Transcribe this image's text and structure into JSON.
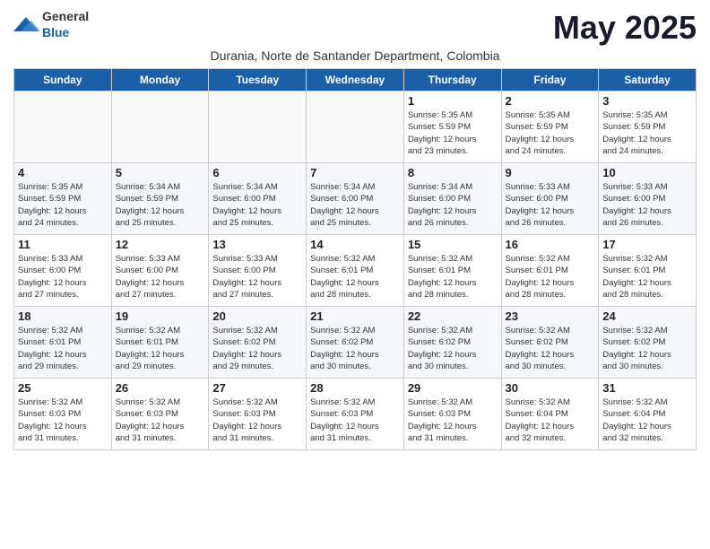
{
  "logo": {
    "general": "General",
    "blue": "Blue"
  },
  "title": {
    "month": "May 2025",
    "location": "Durania, Norte de Santander Department, Colombia"
  },
  "weekdays": [
    "Sunday",
    "Monday",
    "Tuesday",
    "Wednesday",
    "Thursday",
    "Friday",
    "Saturday"
  ],
  "weeks": [
    [
      {
        "day": "",
        "info": ""
      },
      {
        "day": "",
        "info": ""
      },
      {
        "day": "",
        "info": ""
      },
      {
        "day": "",
        "info": ""
      },
      {
        "day": "1",
        "info": "Sunrise: 5:35 AM\nSunset: 5:59 PM\nDaylight: 12 hours\nand 23 minutes."
      },
      {
        "day": "2",
        "info": "Sunrise: 5:35 AM\nSunset: 5:59 PM\nDaylight: 12 hours\nand 24 minutes."
      },
      {
        "day": "3",
        "info": "Sunrise: 5:35 AM\nSunset: 5:59 PM\nDaylight: 12 hours\nand 24 minutes."
      }
    ],
    [
      {
        "day": "4",
        "info": "Sunrise: 5:35 AM\nSunset: 5:59 PM\nDaylight: 12 hours\nand 24 minutes."
      },
      {
        "day": "5",
        "info": "Sunrise: 5:34 AM\nSunset: 5:59 PM\nDaylight: 12 hours\nand 25 minutes."
      },
      {
        "day": "6",
        "info": "Sunrise: 5:34 AM\nSunset: 6:00 PM\nDaylight: 12 hours\nand 25 minutes."
      },
      {
        "day": "7",
        "info": "Sunrise: 5:34 AM\nSunset: 6:00 PM\nDaylight: 12 hours\nand 25 minutes."
      },
      {
        "day": "8",
        "info": "Sunrise: 5:34 AM\nSunset: 6:00 PM\nDaylight: 12 hours\nand 26 minutes."
      },
      {
        "day": "9",
        "info": "Sunrise: 5:33 AM\nSunset: 6:00 PM\nDaylight: 12 hours\nand 26 minutes."
      },
      {
        "day": "10",
        "info": "Sunrise: 5:33 AM\nSunset: 6:00 PM\nDaylight: 12 hours\nand 26 minutes."
      }
    ],
    [
      {
        "day": "11",
        "info": "Sunrise: 5:33 AM\nSunset: 6:00 PM\nDaylight: 12 hours\nand 27 minutes."
      },
      {
        "day": "12",
        "info": "Sunrise: 5:33 AM\nSunset: 6:00 PM\nDaylight: 12 hours\nand 27 minutes."
      },
      {
        "day": "13",
        "info": "Sunrise: 5:33 AM\nSunset: 6:00 PM\nDaylight: 12 hours\nand 27 minutes."
      },
      {
        "day": "14",
        "info": "Sunrise: 5:32 AM\nSunset: 6:01 PM\nDaylight: 12 hours\nand 28 minutes."
      },
      {
        "day": "15",
        "info": "Sunrise: 5:32 AM\nSunset: 6:01 PM\nDaylight: 12 hours\nand 28 minutes."
      },
      {
        "day": "16",
        "info": "Sunrise: 5:32 AM\nSunset: 6:01 PM\nDaylight: 12 hours\nand 28 minutes."
      },
      {
        "day": "17",
        "info": "Sunrise: 5:32 AM\nSunset: 6:01 PM\nDaylight: 12 hours\nand 28 minutes."
      }
    ],
    [
      {
        "day": "18",
        "info": "Sunrise: 5:32 AM\nSunset: 6:01 PM\nDaylight: 12 hours\nand 29 minutes."
      },
      {
        "day": "19",
        "info": "Sunrise: 5:32 AM\nSunset: 6:01 PM\nDaylight: 12 hours\nand 29 minutes."
      },
      {
        "day": "20",
        "info": "Sunrise: 5:32 AM\nSunset: 6:02 PM\nDaylight: 12 hours\nand 29 minutes."
      },
      {
        "day": "21",
        "info": "Sunrise: 5:32 AM\nSunset: 6:02 PM\nDaylight: 12 hours\nand 30 minutes."
      },
      {
        "day": "22",
        "info": "Sunrise: 5:32 AM\nSunset: 6:02 PM\nDaylight: 12 hours\nand 30 minutes."
      },
      {
        "day": "23",
        "info": "Sunrise: 5:32 AM\nSunset: 6:02 PM\nDaylight: 12 hours\nand 30 minutes."
      },
      {
        "day": "24",
        "info": "Sunrise: 5:32 AM\nSunset: 6:02 PM\nDaylight: 12 hours\nand 30 minutes."
      }
    ],
    [
      {
        "day": "25",
        "info": "Sunrise: 5:32 AM\nSunset: 6:03 PM\nDaylight: 12 hours\nand 31 minutes."
      },
      {
        "day": "26",
        "info": "Sunrise: 5:32 AM\nSunset: 6:03 PM\nDaylight: 12 hours\nand 31 minutes."
      },
      {
        "day": "27",
        "info": "Sunrise: 5:32 AM\nSunset: 6:03 PM\nDaylight: 12 hours\nand 31 minutes."
      },
      {
        "day": "28",
        "info": "Sunrise: 5:32 AM\nSunset: 6:03 PM\nDaylight: 12 hours\nand 31 minutes."
      },
      {
        "day": "29",
        "info": "Sunrise: 5:32 AM\nSunset: 6:03 PM\nDaylight: 12 hours\nand 31 minutes."
      },
      {
        "day": "30",
        "info": "Sunrise: 5:32 AM\nSunset: 6:04 PM\nDaylight: 12 hours\nand 32 minutes."
      },
      {
        "day": "31",
        "info": "Sunrise: 5:32 AM\nSunset: 6:04 PM\nDaylight: 12 hours\nand 32 minutes."
      }
    ]
  ]
}
